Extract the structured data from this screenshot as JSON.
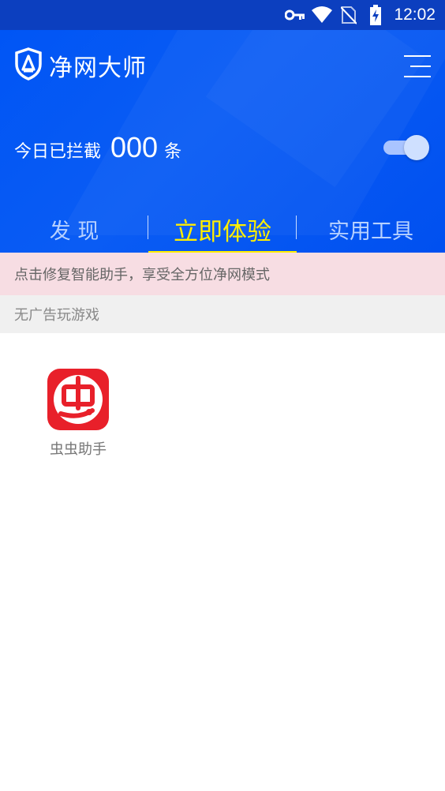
{
  "status_bar": {
    "time": "12:02",
    "icons": [
      "key-icon",
      "wifi-icon",
      "no-sim-icon",
      "battery-charging-icon"
    ]
  },
  "header": {
    "app_title": "净网大师",
    "menu_icon": "menu-icon",
    "blocked_label": "今日已拦截",
    "blocked_count": "000",
    "blocked_unit": "条",
    "protection_enabled": true
  },
  "tabs": [
    {
      "label": "发 现",
      "active": false
    },
    {
      "label": "立即体验",
      "active": true
    },
    {
      "label": "实用工具",
      "active": false
    }
  ],
  "notice": {
    "text": "点击修复智能助手，享受全方位净网模式"
  },
  "section": {
    "title": "无广告玩游戏",
    "apps": [
      {
        "name": "虫虫助手",
        "icon": "chongchong-app-icon"
      }
    ]
  },
  "colors": {
    "header_blue": "#0055f5",
    "status_bar": "#0c3fbf",
    "active_tab": "#ffee00",
    "notice_bg": "#f7dde3",
    "app_icon_red": "#e8202a"
  }
}
